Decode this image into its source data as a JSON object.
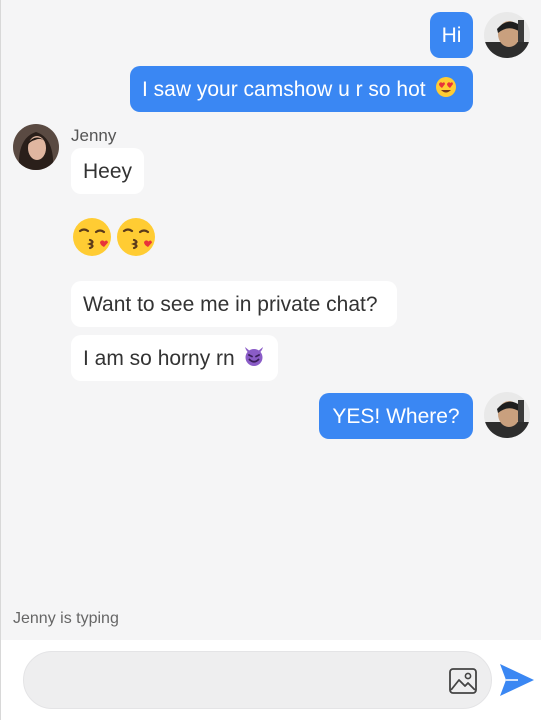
{
  "colors": {
    "outgoing_bubble": "#3a87f3",
    "incoming_bubble": "#ffffff",
    "background": "#f5f5f6",
    "send_icon": "#3a87f3"
  },
  "messages": [
    {
      "direction": "outgoing",
      "text": "Hi"
    },
    {
      "direction": "outgoing",
      "text": "I saw your camshow u r so hot",
      "emoji": "heart-eyes-emoji"
    },
    {
      "direction": "incoming",
      "sender": "Jenny",
      "text": "Heey"
    },
    {
      "direction": "incoming",
      "emoji": "kissing-face-emoji x2"
    },
    {
      "direction": "incoming",
      "text": "Want to see me in private chat?"
    },
    {
      "direction": "incoming",
      "text": "I am so horny rn",
      "emoji": "smiling-devil-emoji"
    },
    {
      "direction": "outgoing",
      "text": "YES! Where?"
    }
  ],
  "status": {
    "typing": "Jenny is typing"
  },
  "composer": {
    "placeholder": "",
    "image_icon": "image-icon",
    "send_icon": "send-icon"
  }
}
